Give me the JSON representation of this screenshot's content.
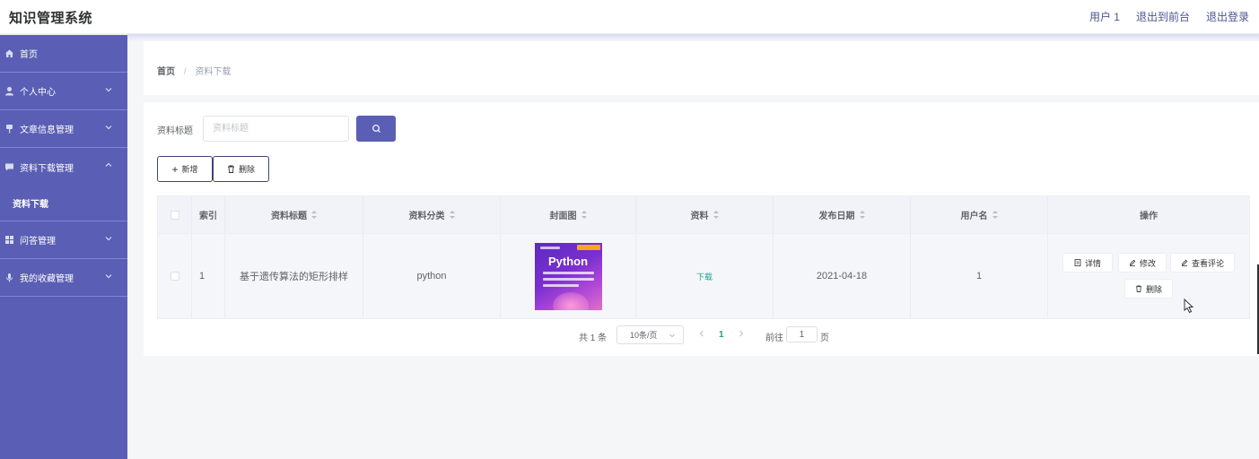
{
  "header": {
    "app_title": "知识管理系统",
    "user_label": "用户 1",
    "exit_front_label": "退出到前台",
    "logout_label": "退出登录"
  },
  "sidebar": {
    "items": [
      {
        "label": "首页",
        "icon": "home-icon"
      },
      {
        "label": "个人中心",
        "icon": "user-icon"
      },
      {
        "label": "文章信息管理",
        "icon": "pin-icon"
      },
      {
        "label": "资料下载管理",
        "icon": "chat-icon",
        "expanded": true
      },
      {
        "label": "问答管理",
        "icon": "grid-icon"
      },
      {
        "label": "我的收藏管理",
        "icon": "mic-icon"
      }
    ],
    "subitem": "资料下载"
  },
  "breadcrumb": {
    "home": "首页",
    "separator": "/",
    "current": "资料下载"
  },
  "search": {
    "label": "资料标题",
    "placeholder": "资料标题"
  },
  "toolbar": {
    "add_label": "新增",
    "delete_label": "删除"
  },
  "table": {
    "columns": [
      "索引",
      "资料标题",
      "资料分类",
      "封面图",
      "资料",
      "发布日期",
      "用户名",
      "操作"
    ],
    "rows": [
      {
        "index": "1",
        "title": "基于遗传算法的矩形排样",
        "category": "python",
        "cover_text": "Python",
        "file_link": "下载",
        "date": "2021-04-18",
        "username": "1"
      }
    ],
    "actions": {
      "detail": "详情",
      "edit": "修改",
      "comments": "查看评论",
      "delete": "删除"
    }
  },
  "pagination": {
    "total_text": "共 1 条",
    "page_size": "10条/页",
    "current_page": "1",
    "goto_label": "前往",
    "goto_value": "1",
    "page_unit": "页"
  },
  "colors": {
    "sidebar_bg": "#5a5eb4",
    "primary": "#5a5eb4",
    "link": "#1aa18c"
  }
}
